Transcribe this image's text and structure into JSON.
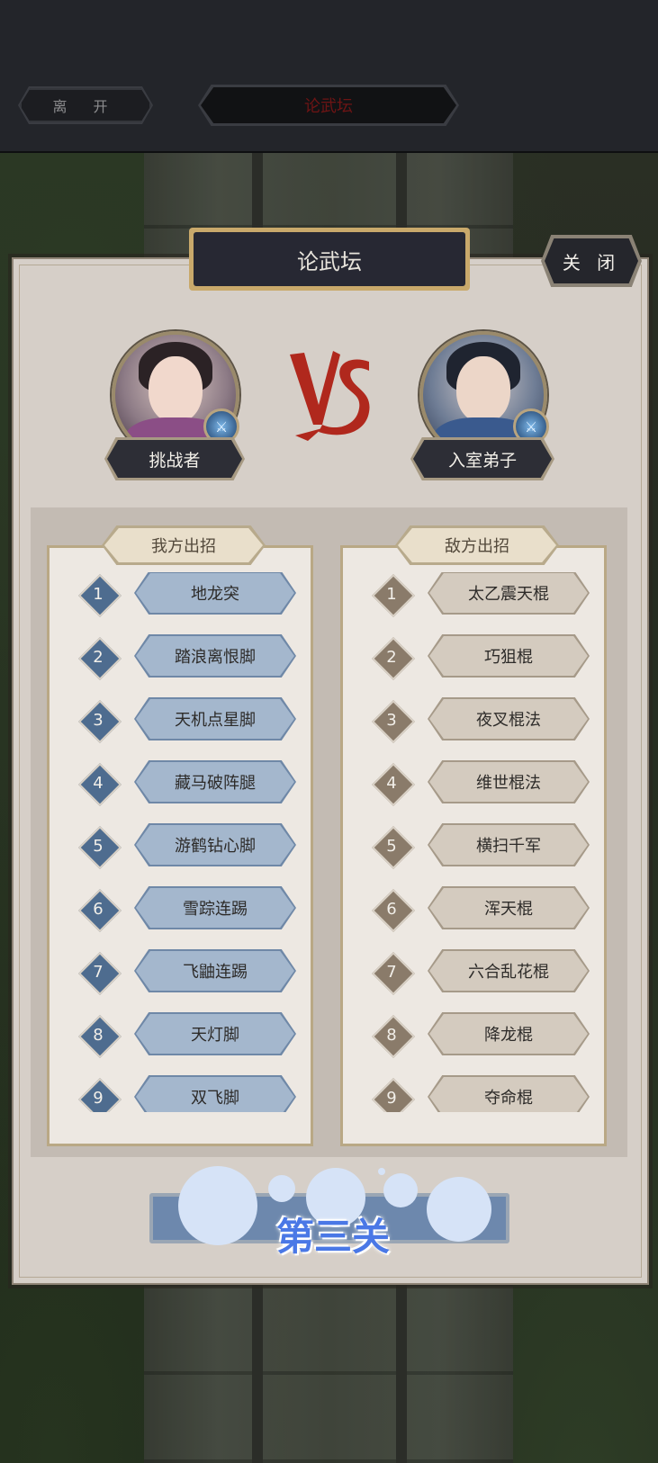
{
  "top_bar": {
    "leave_label": "离 开",
    "title": "论武坛"
  },
  "panel": {
    "title": "论武坛",
    "close_label": "关 闭"
  },
  "challenger": {
    "name": "挑战者"
  },
  "opponent": {
    "name": "入室弟子"
  },
  "my_moves": {
    "header": "我方出招",
    "items": [
      {
        "num": "1",
        "name": "地龙突"
      },
      {
        "num": "2",
        "name": "踏浪离恨脚"
      },
      {
        "num": "3",
        "name": "天机点星脚"
      },
      {
        "num": "4",
        "name": "藏马破阵腿"
      },
      {
        "num": "5",
        "name": "游鹤钻心脚"
      },
      {
        "num": "6",
        "name": "雪踪连踢"
      },
      {
        "num": "7",
        "name": "飞鼬连踢"
      },
      {
        "num": "8",
        "name": "天灯脚"
      },
      {
        "num": "9",
        "name": "双飞脚"
      }
    ]
  },
  "enemy_moves": {
    "header": "敌方出招",
    "items": [
      {
        "num": "1",
        "name": "太乙震天棍"
      },
      {
        "num": "2",
        "name": "巧狙棍"
      },
      {
        "num": "3",
        "name": "夜叉棍法"
      },
      {
        "num": "4",
        "name": "维世棍法"
      },
      {
        "num": "5",
        "name": "横扫千军"
      },
      {
        "num": "6",
        "name": "浑天棍"
      },
      {
        "num": "7",
        "name": "六合乱花棍"
      },
      {
        "num": "8",
        "name": "降龙棍"
      },
      {
        "num": "9",
        "name": "夺命棍"
      }
    ]
  },
  "stage": {
    "label": "第三关"
  },
  "colors": {
    "my_pill": "#a4b7cd",
    "enemy_pill": "#d4cbbf",
    "vs_red": "#b0281d",
    "stage_text": "#4a78e6"
  }
}
